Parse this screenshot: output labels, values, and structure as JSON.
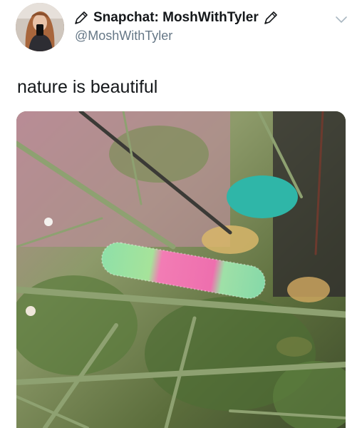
{
  "tweet": {
    "display_name": "Snapchat: MoshWithTyler",
    "handle": "@MoshWithTyler",
    "text": "nature is beautiful",
    "icons": {
      "avatar": "user-avatar-photo",
      "name_prefix": "pencil-icon",
      "name_suffix": "pencil-icon",
      "menu": "chevron-down-icon"
    },
    "media": {
      "subject": "pink-and-green-gummy-worm-on-branches"
    }
  },
  "colors": {
    "name": "#14171a",
    "handle": "#657786",
    "chevron": "#aab8c2"
  }
}
